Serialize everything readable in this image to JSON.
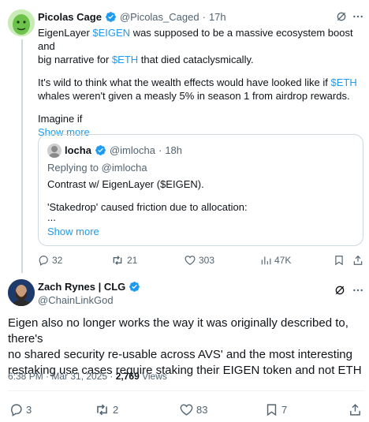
{
  "tweet1": {
    "name": "Picolas Cage",
    "handle": "@Picolas_Caged",
    "time": "17h",
    "line1_a": "EigenLayer ",
    "line1_tag": "$EIGEN",
    "line1_b": " was supposed to be a massive ecosystem boost and",
    "line2_a": "big narrative for ",
    "line2_tag": "$ETH",
    "line2_b": " that died cataclysmically.",
    "line3_a": "It's wild to think what the wealth effects would have looked like if ",
    "line3_tag": "$ETH",
    "line4": "whales weren't given a measly 5% in season 1 from airdrop rewards.",
    "line5": "Imagine if",
    "show_more": "Show more",
    "quote": {
      "name": "locha",
      "handle": "@imlocha",
      "time": "18h",
      "replying": "Replying to @imlocha",
      "line1": "Contrast w/ EigenLayer ($EIGEN).",
      "line2": "'Stakedrop' caused friction due to allocation:",
      "line3": "...",
      "show_more": "Show more"
    },
    "stats": {
      "replies": "32",
      "reposts": "21",
      "likes": "303",
      "views": "47K"
    }
  },
  "tweet2": {
    "name": "Zach Rynes | CLG",
    "handle": "@ChainLinkGod",
    "text_line1": "Eigen also no longer works the way it was originally described to, there's",
    "text_line2": "no shared security re-usable across AVS' and the most interesting",
    "text_line3": "restaking use cases require staking their EIGEN token and not ETH",
    "timestamp": "6:38 PM · Mar 31, 2025 · ",
    "views_count": "2,769",
    "views_label": " Views",
    "stats": {
      "replies": "3",
      "reposts": "2",
      "likes": "83",
      "bookmarks": "7"
    }
  },
  "colors": {
    "accent": "#1d9bf0",
    "muted": "#536471",
    "border": "#cfd9de"
  }
}
